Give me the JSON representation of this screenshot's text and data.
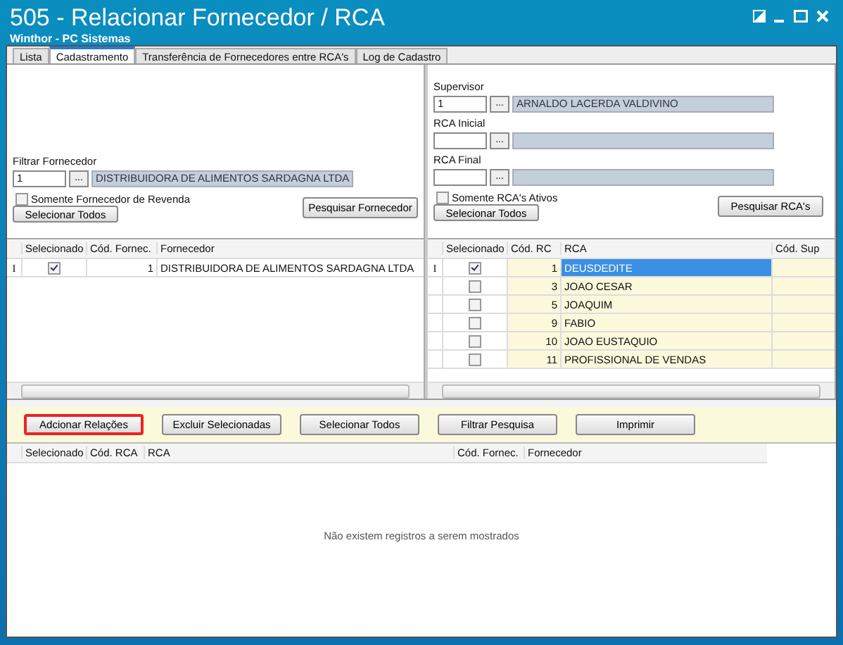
{
  "window": {
    "title": "505 - Relacionar Fornecedor / RCA",
    "subtitle": "Winthor - PC Sistemas"
  },
  "tabs": [
    {
      "label": "Lista",
      "selected": false
    },
    {
      "label": "Cadastramento",
      "selected": true
    },
    {
      "label": "Transferência de Fornecedores entre RCA's",
      "selected": false
    },
    {
      "label": "Log de Cadastro",
      "selected": false
    }
  ],
  "fornecedor_filter": {
    "label": "Filtrar Fornecedor",
    "code": "1",
    "lookup_button": "...",
    "name": "DISTRIBUIDORA DE ALIMENTOS SARDAGNA LTDA",
    "checkbox": {
      "label": "Somente Fornecedor de Revenda",
      "checked": false
    },
    "select_all_button": "Selecionar Todos",
    "search_button": "Pesquisar Fornecedor"
  },
  "rca_filter": {
    "fields": [
      {
        "label": "Supervisor",
        "code": "1",
        "lookup_button": "...",
        "name": "ARNALDO LACERDA VALDIVINO"
      },
      {
        "label": "RCA Inicial",
        "lookup_button": "..."
      },
      {
        "label": "RCA Final",
        "lookup_button": "..."
      }
    ],
    "checkbox": {
      "label": "Somente RCA's Ativos",
      "checked": false
    },
    "select_all_button": "Selecionar Todos",
    "search_button": "Pesquisar RCA's"
  },
  "fornecedor_grid": {
    "columns": [
      "Selecionado",
      "Cód. Fornec.",
      "Fornecedor"
    ],
    "rows": [
      {
        "cursor": "I",
        "checked": true,
        "code": "1",
        "name": "DISTRIBUIDORA DE ALIMENTOS SARDAGNA LTDA",
        "selected": false
      }
    ]
  },
  "rca_grid": {
    "columns": [
      "Selecionado",
      "Cód. RC",
      "RCA",
      "Cód. Sup"
    ],
    "rows": [
      {
        "cursor": "I",
        "checked": true,
        "code": "1",
        "name": "DEUSDEDITE",
        "selected": true
      },
      {
        "checked": false,
        "code": "3",
        "name": "JOAO CESAR",
        "selected": false
      },
      {
        "checked": false,
        "code": "5",
        "name": "JOAQUIM",
        "selected": false
      },
      {
        "checked": false,
        "code": "9",
        "name": "FABIO",
        "selected": false
      },
      {
        "checked": false,
        "code": "10",
        "name": "JOAO EUSTAQUIO",
        "selected": false
      },
      {
        "checked": false,
        "code": "11",
        "name": "PROFISSIONAL DE VENDAS",
        "selected": false
      }
    ]
  },
  "toolbar_buttons": [
    {
      "label": "Adcionar Relações",
      "highlighted": true
    },
    {
      "label": "Excluir Selecionadas",
      "highlighted": false
    },
    {
      "label": "Selecionar Todos",
      "highlighted": false
    },
    {
      "label": "Filtrar Pesquisa",
      "highlighted": false
    },
    {
      "label": "Imprimir",
      "highlighted": false
    }
  ],
  "relations_grid": {
    "columns": [
      "Selecionado",
      "Cód. RCA",
      "RCA",
      "Cód. Fornec.",
      "Fornecedor"
    ],
    "empty_message": "Não existem registros a serem mostrados"
  }
}
